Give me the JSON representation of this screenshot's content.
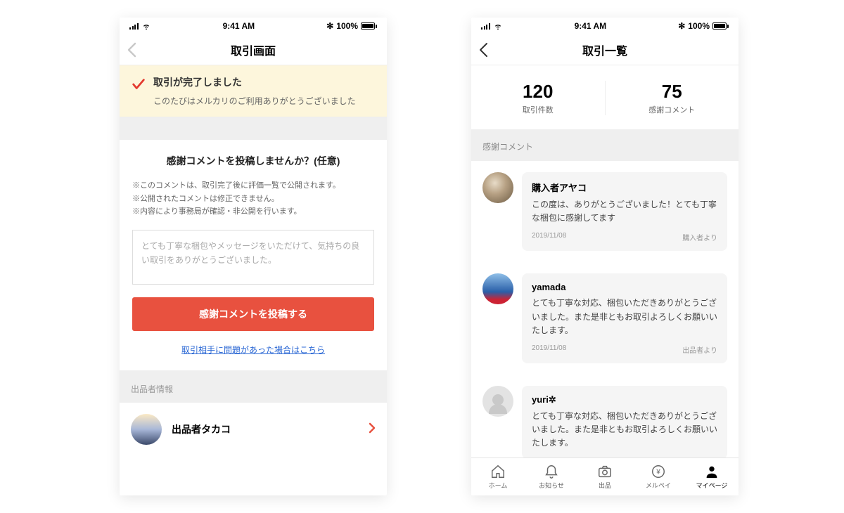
{
  "statusbar": {
    "time": "9:41 AM",
    "battery": "100%",
    "bt": "✱"
  },
  "left": {
    "title": "取引画面",
    "banner": {
      "title": "取引が完了しました",
      "sub": "このたびはメルカリのご利用ありがとうございました"
    },
    "comment": {
      "heading": "感謝コメントを投稿しませんか？(任意)",
      "note1": "※このコメントは、取引完了後に評価一覧で公開されます。",
      "note2": "※公開されたコメントは修正できません。",
      "note3": "※内容により事務局が確認・非公開を行います。",
      "placeholder": "とても丁寧な梱包やメッセージをいただけて、気持ちの良い取引をありがとうございました。",
      "button": "感謝コメントを投稿する",
      "link": "取引相手に問題があった場合はこちら"
    },
    "seller_section_label": "出品者情報",
    "seller_name": "出品者タカコ"
  },
  "right": {
    "title": "取引一覧",
    "stats": {
      "count_num": "120",
      "count_label": "取引件数",
      "thanks_num": "75",
      "thanks_label": "感謝コメント"
    },
    "section_label": "感謝コメント",
    "comments": [
      {
        "name": "購入者アヤコ",
        "body": "この度は、ありがとうございました！とても丁寧な梱包に感謝してます",
        "date": "2019/11/08",
        "role": "購入者より"
      },
      {
        "name": "yamada",
        "body": "とても丁寧な対応、梱包いただきありがとうございました。また是非ともお取引よろしくお願いいたします。",
        "date": "2019/11/08",
        "role": "出品者より"
      },
      {
        "name": "yuri✲",
        "body": "とても丁寧な対応、梱包いただきありがとうございました。また是非ともお取引よろしくお願いいたします。",
        "date": "",
        "role": ""
      }
    ],
    "tabs": {
      "home": "ホーム",
      "notice": "お知らせ",
      "sell": "出品",
      "merpay": "メルペイ",
      "mypage": "マイページ"
    }
  }
}
